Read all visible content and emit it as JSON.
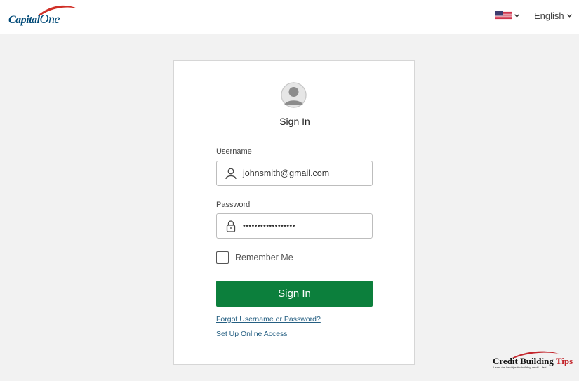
{
  "header": {
    "logo_text_main": "Capital",
    "logo_text_one": "One",
    "country_flag_icon": "us-flag-icon",
    "language_label": "English"
  },
  "signin": {
    "title": "Sign In",
    "username_label": "Username",
    "username_value": "johnsmith@gmail.com",
    "password_label": "Password",
    "password_value": "••••••••••••••••••",
    "remember_label": "Remember Me",
    "remember_checked": false,
    "button_label": "Sign In",
    "forgot_link": "Forgot Username or Password?",
    "setup_link": "Set Up Online Access"
  },
  "watermark": {
    "title_main": "Credit Building ",
    "title_accent": "Tips",
    "subtitle": "Learn the best tips for building credit... fast."
  },
  "colors": {
    "brand_blue": "#004977",
    "brand_red": "#d03027",
    "button_green": "#0c7f3c",
    "link_blue": "#255f82",
    "page_bg": "#f2f2f2"
  }
}
